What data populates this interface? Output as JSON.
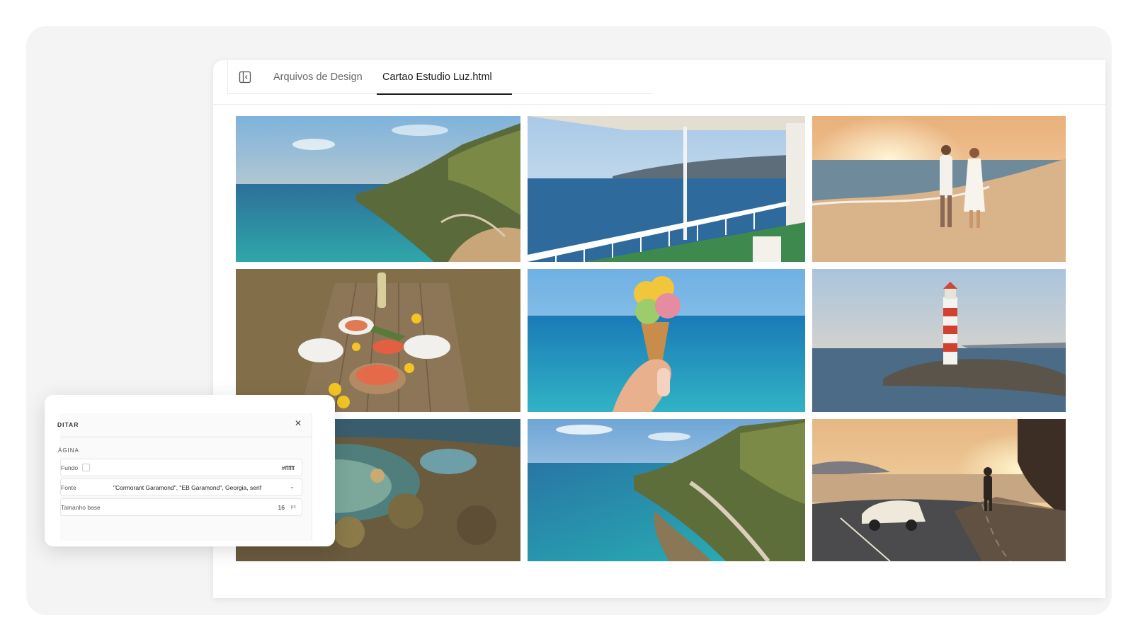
{
  "window": {
    "tabs": [
      {
        "label": "Arquivos de Design",
        "active": false
      },
      {
        "label": "Cartao Estudio Luz.html",
        "active": true
      }
    ],
    "sidebar_toggle_icon": "sidebar-toggle-icon"
  },
  "gallery": {
    "photos": [
      {
        "name": "coastal-cliff-road",
        "subject": "sea-cliff"
      },
      {
        "name": "ferry-deck-view",
        "subject": "ferry-deck"
      },
      {
        "name": "couple-beach-sunset",
        "subject": "beach-couple"
      },
      {
        "name": "seafood-picnic-table",
        "subject": "seafood-table"
      },
      {
        "name": "ice-cream-cone-sea",
        "subject": "ice-cream"
      },
      {
        "name": "lighthouse-jetty",
        "subject": "lighthouse"
      },
      {
        "name": "rock-tide-pools",
        "subject": "tide-pools"
      },
      {
        "name": "coastal-road-bay",
        "subject": "coastal-road"
      },
      {
        "name": "convertible-sunset-road",
        "subject": "convertible-road"
      }
    ]
  },
  "edit_panel": {
    "title": "DITAR",
    "close_icon": "close-icon",
    "section": "ÁGINA",
    "fields": {
      "background": {
        "label": "Fundo",
        "value": "#ffffff"
      },
      "font": {
        "label": "Fonte",
        "value": "\"Cormorant Garamond\", \"EB Garamond\", Georgia, serif"
      },
      "base_size": {
        "label": "Tamanho base",
        "value": "16",
        "unit": "px"
      }
    }
  },
  "colors": {
    "accent": "#1b1b1b",
    "backdrop": "#f4f4f4"
  }
}
